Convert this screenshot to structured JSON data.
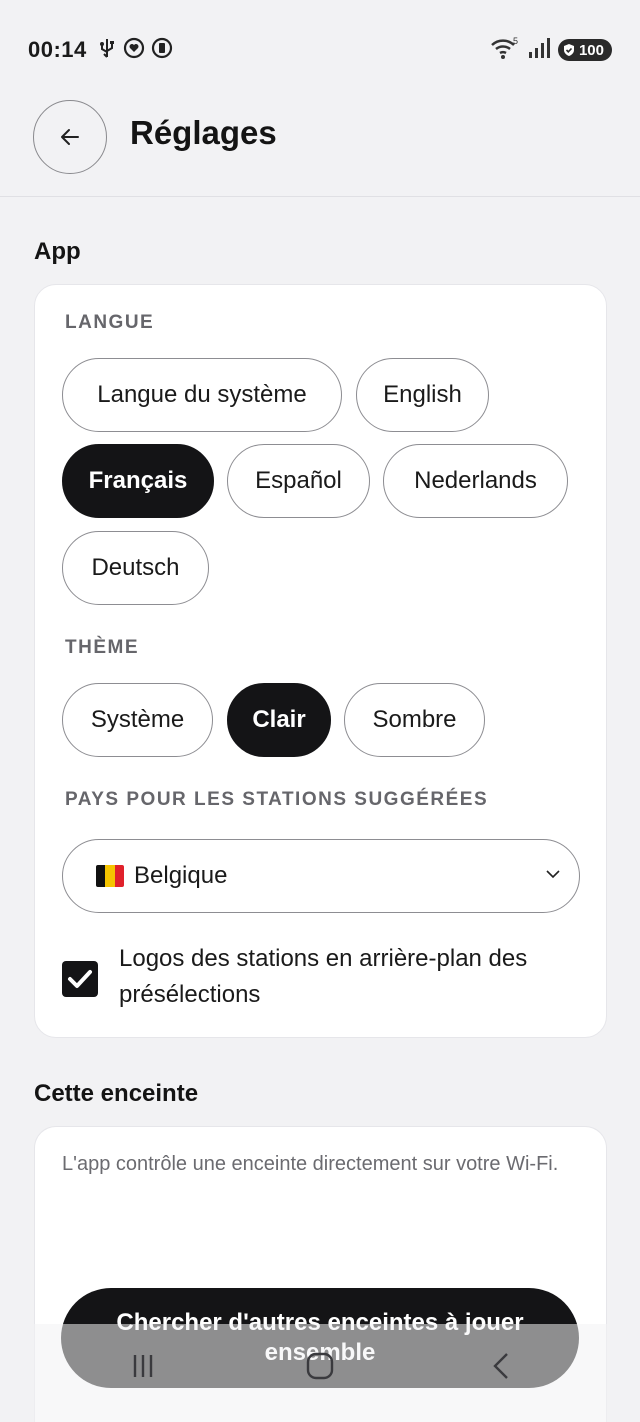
{
  "status_bar": {
    "time": "00:14",
    "icons": [
      "usb-icon",
      "heart-circle-icon",
      "battery-saver-icon"
    ],
    "right_icons": [
      "wifi-icon",
      "signal-icon"
    ],
    "wifi_badge": "5",
    "battery_level": "100"
  },
  "header": {
    "back_icon": "arrow-left-icon",
    "title": "Réglages"
  },
  "app_section": {
    "title": "App",
    "language": {
      "label": "LANGUE",
      "options": [
        "Langue du système",
        "English",
        "Français",
        "Español",
        "Nederlands",
        "Deutsch"
      ],
      "selected": "Français"
    },
    "theme": {
      "label": "THÈME",
      "options": [
        "Système",
        "Clair",
        "Sombre"
      ],
      "selected": "Clair"
    },
    "country": {
      "label": "PAYS POUR LES STATIONS SUGGÉRÉES",
      "selected": "Belgique",
      "flag_colors": [
        "#111111",
        "#f5c400",
        "#e0212b"
      ]
    },
    "station_logos": {
      "label": "Logos des stations en arrière-plan des présélections",
      "checked": true
    }
  },
  "speaker_section": {
    "title": "Cette enceinte",
    "description": "L'app contrôle une enceinte directement sur votre Wi-Fi.",
    "search_button": "Chercher d'autres enceintes à jouer ensemble"
  },
  "nav": {
    "buttons": [
      "recents-icon",
      "home-icon",
      "back-icon"
    ]
  }
}
